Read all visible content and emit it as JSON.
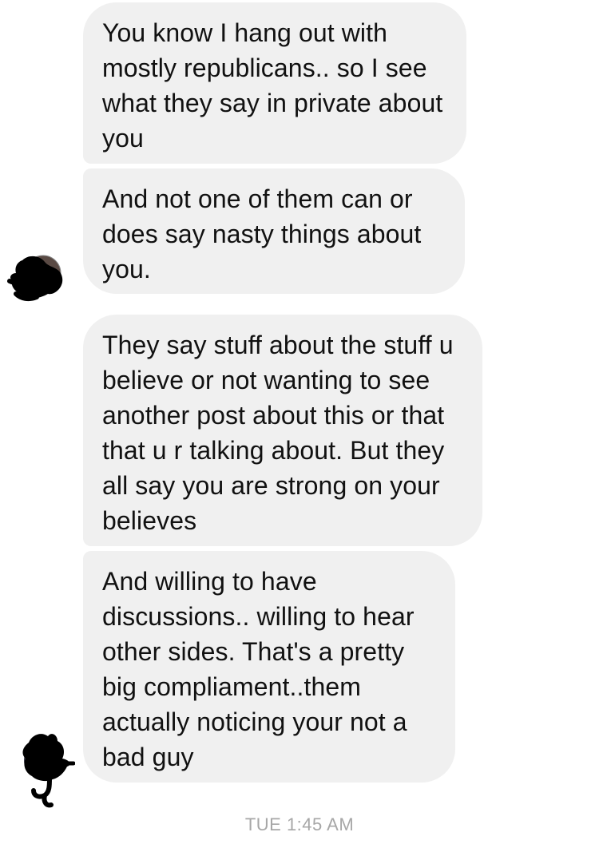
{
  "thread": {
    "messages": [
      {
        "text": "You know I hang out with mostly republicans.. so I see what they say in private about you"
      },
      {
        "text": "And not one of them can or does say nasty things about you."
      },
      {
        "text": "They say stuff about the stuff u believe or not wanting to see another post about this or that that u r talking about. But they all say you are strong on your believes"
      },
      {
        "text": "And willing to have discussions.. willing to hear other sides. That's a pretty big compliament..them actually noticing your not a bad guy"
      }
    ],
    "timestamp": "TUE 1:45 AM"
  },
  "colors": {
    "bubble_bg": "#f0f0f0",
    "text": "#111111",
    "timestamp": "#a7a7a7",
    "scribble": "#000000"
  },
  "icons": {
    "avatar_1": "scribbled-avatar",
    "avatar_2": "scribbled-avatar"
  }
}
